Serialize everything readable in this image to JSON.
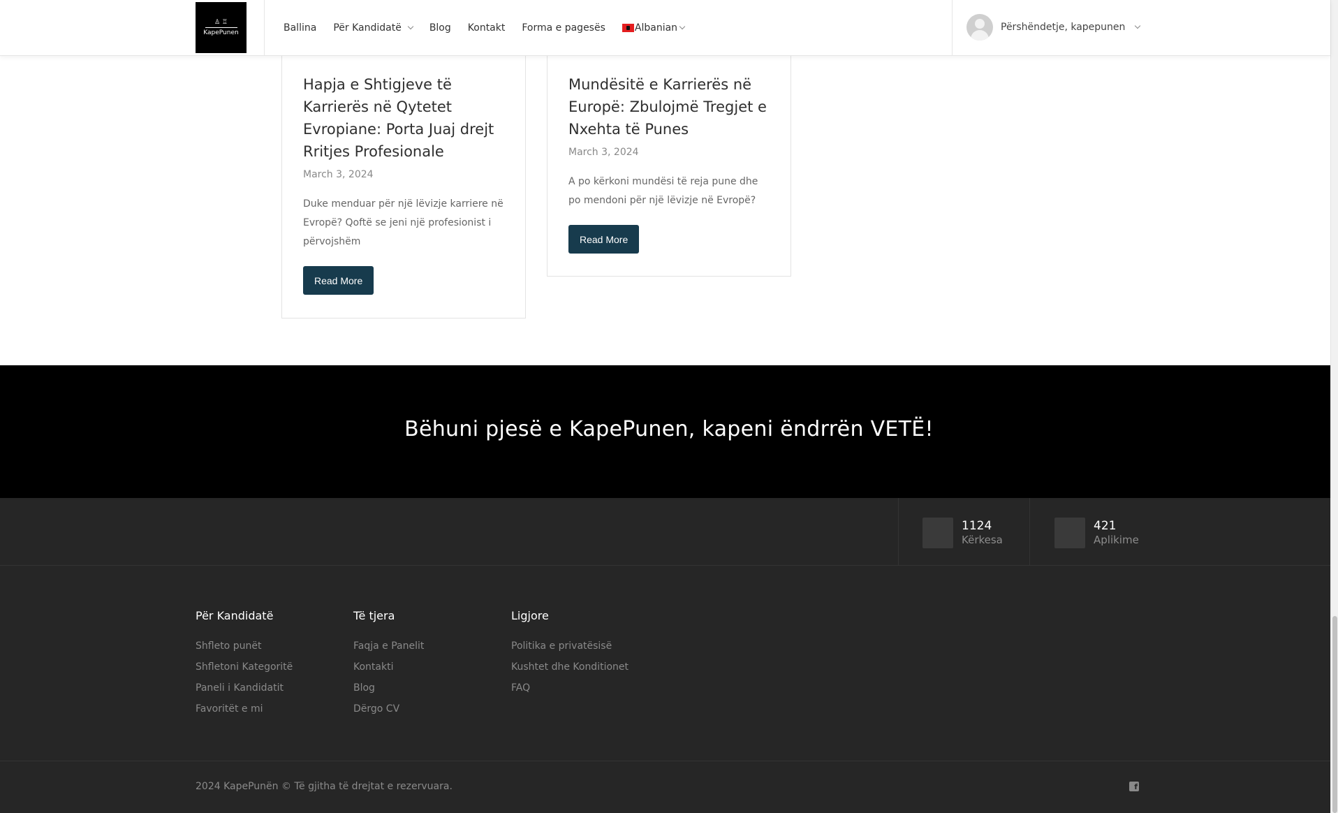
{
  "header": {
    "logo_text": "KapePunen",
    "nav": [
      {
        "label": "Ballina"
      },
      {
        "label": "Për Kandidatë"
      },
      {
        "label": "Blog"
      },
      {
        "label": "Kontakt"
      },
      {
        "label": "Forma e pagesës"
      },
      {
        "label": "Albanian"
      }
    ],
    "user_greeting": "Përshëndetje, kapepunen"
  },
  "posts": [
    {
      "title": "Hapja e Shtigjeve të Karrierës në Qytetet Evropiane: Porta Juaj drejt Rritjes Profesionale",
      "date": "March 3, 2024",
      "excerpt": "Duke menduar për një lëvizje karriere në Evropë? Qoftë se jeni një profesionist i përvojshëm",
      "button": "Read More"
    },
    {
      "title": "Mundësitë e Karrierës në Europë: Zbulojmë Tregjet e Nxehta të Punes",
      "date": "March 3, 2024",
      "excerpt": "A po kërkoni mundësi të reja pune dhe po mendoni për një lëvizje në Evropë?",
      "button": "Read More"
    }
  ],
  "banner": {
    "title": "Bëhuni pjesë e KapePunen, kapeni ëndrrën VETË!"
  },
  "stats": [
    {
      "value": "1124",
      "label": "Kërkesa"
    },
    {
      "value": "421",
      "label": "Aplikime"
    }
  ],
  "footer": {
    "columns": [
      {
        "title": "Për Kandidatë",
        "links": [
          "Shfleto punët",
          "Shfletoni Kategoritë",
          "Paneli i Kandidatit",
          "Favoritët e mi"
        ]
      },
      {
        "title": "Të tjera",
        "links": [
          "Faqja e Panelit",
          "Kontakti",
          "Blog",
          "Dërgo CV"
        ]
      },
      {
        "title": "Ligjore",
        "links": [
          "Politika e privatësisë",
          "Kushtet dhe Konditionet",
          "FAQ"
        ]
      }
    ],
    "copyright": "2024 KapePunën © Të gjitha të drejtat e rezervuara."
  },
  "colors": {
    "button_bg": "#173b4d",
    "banner_bg": "#000000",
    "footer_bg": "#262626"
  }
}
